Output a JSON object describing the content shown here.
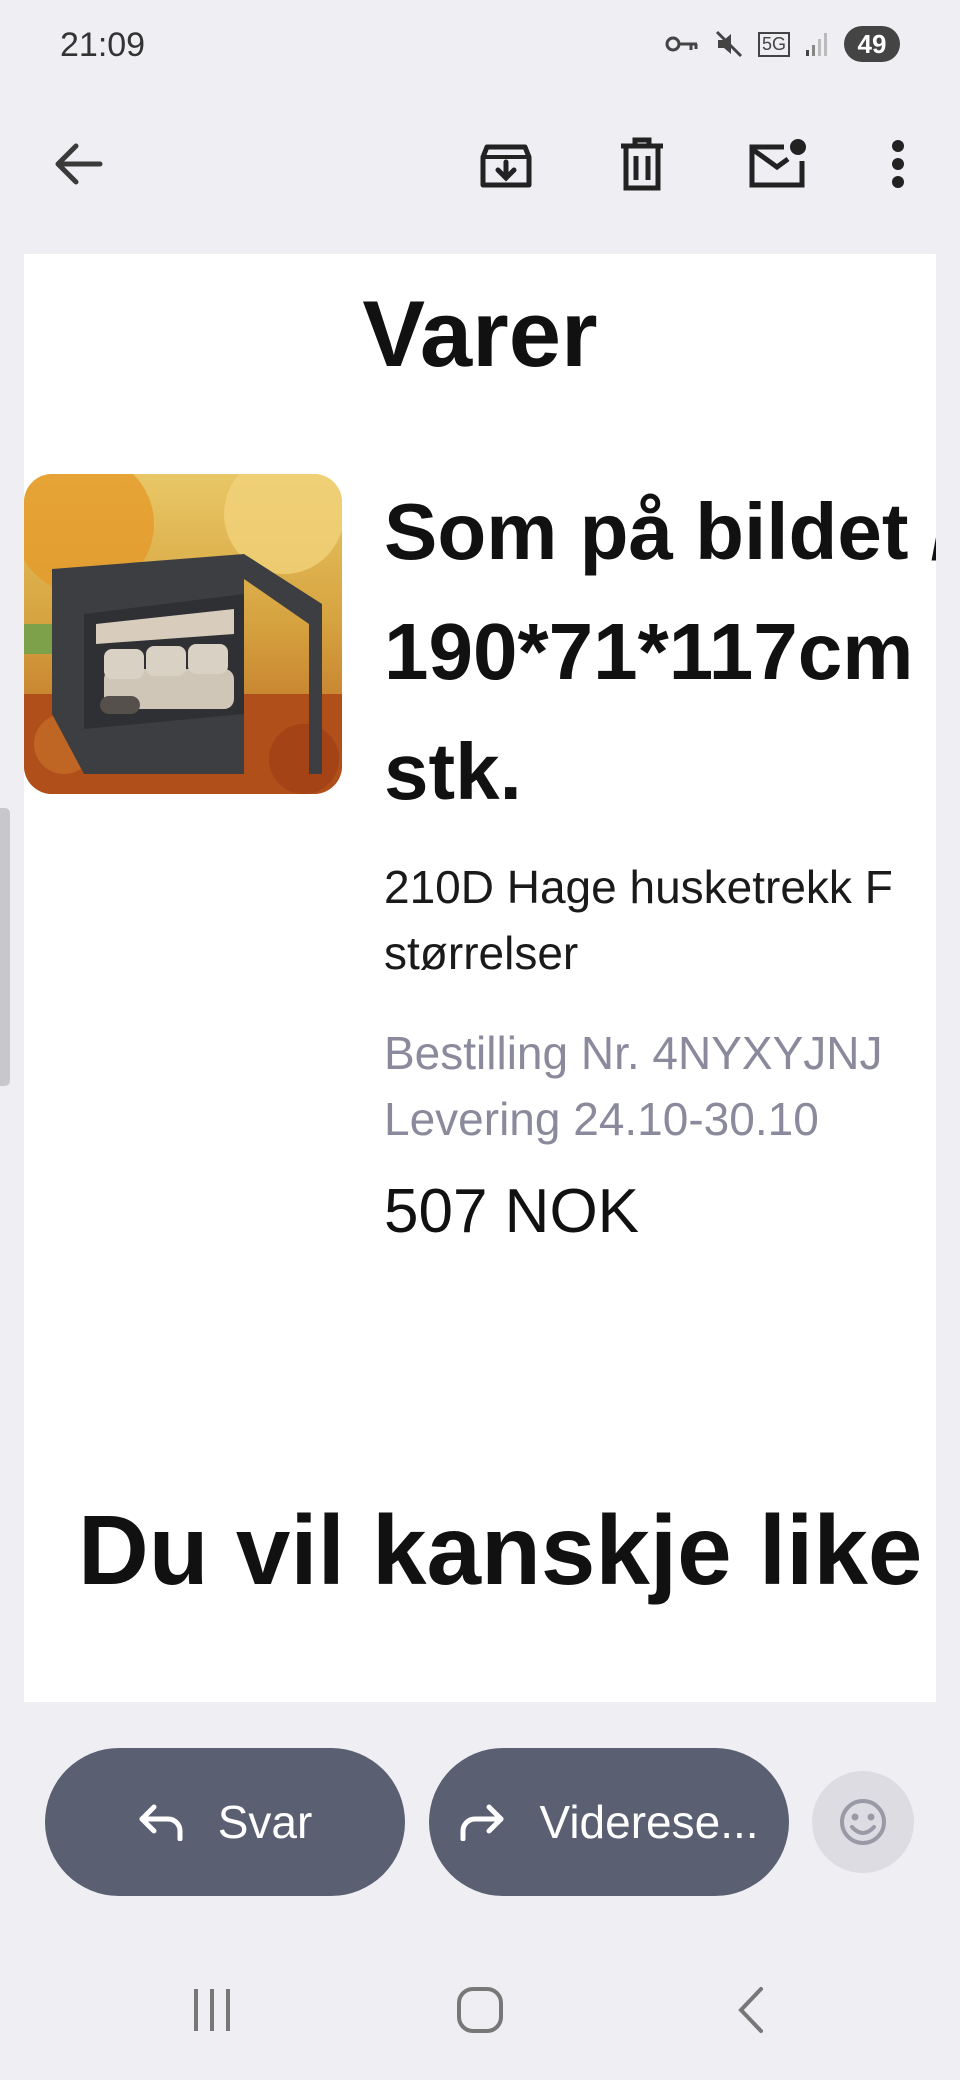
{
  "status_bar": {
    "time": "21:09",
    "network": "5G",
    "battery": "49",
    "icons": [
      "vpn-key-icon",
      "mute-icon",
      "5g-icon",
      "signal-icon",
      "battery-icon"
    ]
  },
  "app_bar": {
    "icons": [
      "back-arrow-icon",
      "archive-icon",
      "delete-icon",
      "mark-unread-icon",
      "more-vert-icon"
    ]
  },
  "email": {
    "section_title": "Varer",
    "product": {
      "image_icon": "product-image",
      "title_line1": "Som på bildet /",
      "title_line2": "190*71*117cm",
      "title_line3": "stk.",
      "desc_line1": "210D Hage husketrekk F",
      "desc_line2": "størrelser",
      "order_line": "Bestilling Nr. 4NYXYJNJ",
      "delivery_line": "Levering 24.10-30.10",
      "price": "507 NOK"
    },
    "suggestions_title": "Du vil kanskje like d"
  },
  "actions": {
    "reply_label": "Svar",
    "forward_label": "Viderese...",
    "reply_icon": "reply-icon",
    "forward_icon": "forward-icon",
    "emoji_icon": "emoji-icon"
  },
  "colors": {
    "background": "#eeeef3",
    "button": "#5a5f72",
    "muted_text": "#8a8a9c"
  }
}
